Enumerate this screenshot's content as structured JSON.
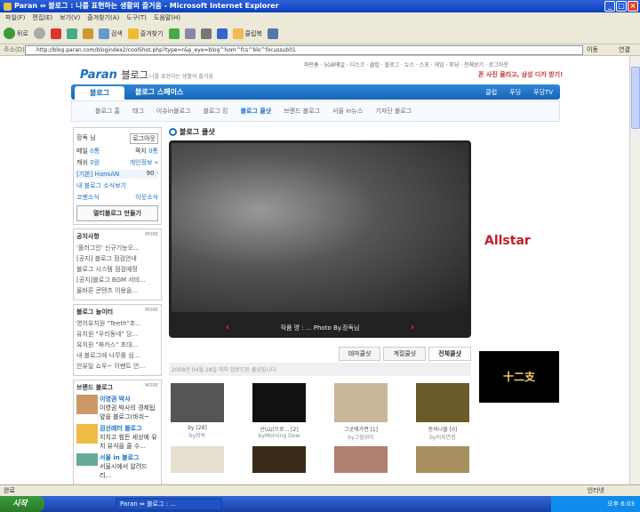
{
  "window": {
    "title": "Paran ⇔ 블로그 : 나를 표현하는 생활의 즐거움 - Microsoft Internet Explorer"
  },
  "menu": [
    "파일(F)",
    "편집(E)",
    "보기(V)",
    "즐겨찾기(A)",
    "도구(T)",
    "도움말(H)"
  ],
  "toolbar": {
    "back": "뒤로",
    "search": "검색",
    "favorites": "즐겨찾기",
    "clipboard": "클립북"
  },
  "address": {
    "label": "주소(D)",
    "url": "http://blog.paran.com/blogindex2/coolShot.php?type=r&p_eye=blog^hom^fcs^blo^focussub01",
    "go": "이동",
    "links": "연결"
  },
  "page": {
    "topnav": "파란홈 · 5GB메일 · 디스크 · 클럽 · 블로그 · 뉴스 · 스포 · 게임 · 푸딩 · 전체보기 · 로그아웃",
    "logo": "Paran",
    "logo_sub": "블로그",
    "tagline": "나를 표현하는 생활의 즐거움",
    "promo": "폰 사진 올리고, 삼성 디카 받기!",
    "tab_blog": "블로그",
    "tab_space": "블로그 스페이스",
    "right_links": [
      "클럽",
      "푸딩",
      "푸딩TV"
    ],
    "subnav": [
      "블로그 홈",
      "태그",
      "이슈in블로그",
      "블로그 킹",
      "블로그 쿨샷",
      "브랜드 블로그",
      "서울 in뉴스",
      "기자단 블로그"
    ],
    "user": {
      "name": "장독 님",
      "logout": "로그아웃",
      "mail": "메일",
      "mail_count": "0통",
      "note": "쪽지",
      "note_count": "0통",
      "cash": "캐쉬",
      "cash_count": "0원",
      "info": "개인정보 »",
      "basic": "[기본] HansAN",
      "basic_count": "90 ·",
      "news": "내 블로그 소식보기",
      "comments": "코멘소식",
      "neighbors": "이웃소식",
      "multi": "멀티블로그 만들기"
    },
    "notice": {
      "title": "공지사항",
      "more": "MORE",
      "items": [
        "'플러그인' 신규기능오...",
        "[공지] 블로그 점검안내",
        "블로그 시스템 점검예정",
        "[공지]블로그 BGM 서비...",
        "올바른 콘텐츠 이용을..."
      ]
    },
    "playground": {
      "title": "블로그 놀이터",
      "more": "MORE",
      "items": [
        "영어유치원 \"Teeth\"초...",
        "유치원 \"우리동네\" 당...",
        "유치원 \"짜카스\" 초대...",
        "내 블로그에 나무를 심...",
        "안유일 쇼우~ 이벤트 안..."
      ]
    },
    "brand": {
      "title": "브랜드 블로그",
      "more": "MORE",
      "items": [
        {
          "name": "이영권 박사",
          "desc": "이영권 박사의 경제팁 앞을 블로그(바쉬~"
        },
        {
          "name": "검선레터 블로그",
          "desc": "지치고 힘든 세상에 유치 유식을 줄 수..."
        },
        {
          "name": "서울 in 블로그",
          "desc": "서울시에서 알려드리..."
        }
      ]
    },
    "main_title": "블로그 쿨샷",
    "caption": "작품 명 : ... Photo By.장독님",
    "tabs": [
      "테마쿨샷",
      "계절쿨샷",
      "전체쿨샷"
    ],
    "note": "2008년 04월 28일 까지 업로드된 쿨샷입니다.",
    "thumbs": [
      {
        "t": "by [28]",
        "s": "by장독"
      },
      {
        "t": "산(山)으로... [2]",
        "s": "byMorning Dew"
      },
      {
        "t": "그곳에가면 [1]",
        "s": "by그림위이"
      },
      {
        "t": "동의나물 [0]",
        "s": "by이지연정"
      }
    ],
    "ad1": "Allstar",
    "ad2": "十二支"
  },
  "status": {
    "text": "완료",
    "zone": "인터넷"
  },
  "taskbar": {
    "start": "시작",
    "item": "Paran ⇔ 블로그 : ...",
    "clock": "오후 6:03"
  }
}
